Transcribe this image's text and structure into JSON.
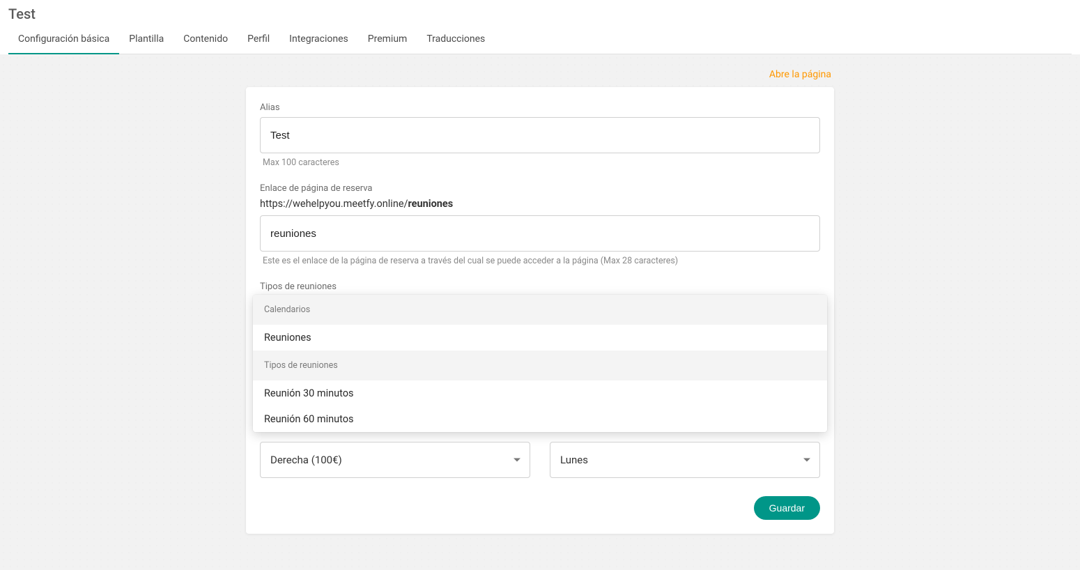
{
  "header": {
    "title": "Test"
  },
  "tabs": [
    {
      "label": "Configuración básica",
      "active": true
    },
    {
      "label": "Plantilla",
      "active": false
    },
    {
      "label": "Contenido",
      "active": false
    },
    {
      "label": "Perfil",
      "active": false
    },
    {
      "label": "Integraciones",
      "active": false
    },
    {
      "label": "Premium",
      "active": false
    },
    {
      "label": "Traducciones",
      "active": false
    }
  ],
  "open_page_link": "Abre la página",
  "form": {
    "alias": {
      "label": "Alias",
      "value": "Test",
      "helper": "Max 100 caracteres"
    },
    "booking_link": {
      "label": "Enlace de página de reserva",
      "base_url": "https://wehelpyou.meetfy.online/",
      "slug": "reuniones",
      "input_value": "reuniones",
      "helper": "Este es el enlace de la página de reserva a través del cual se puede acceder a la página (Max 28 caracteres)"
    },
    "meeting_types": {
      "label": "Tipos de reuniones",
      "groups": [
        {
          "header": "Calendarios",
          "options": [
            "Reuniones"
          ]
        },
        {
          "header": "Tipos de reuniones",
          "options": [
            "Reunión 30 minutos",
            "Reunión 60 minutos"
          ]
        }
      ]
    },
    "select_left": {
      "value": "Derecha (100€)"
    },
    "select_right": {
      "value": "Lunes"
    },
    "save_label": "Guardar"
  }
}
